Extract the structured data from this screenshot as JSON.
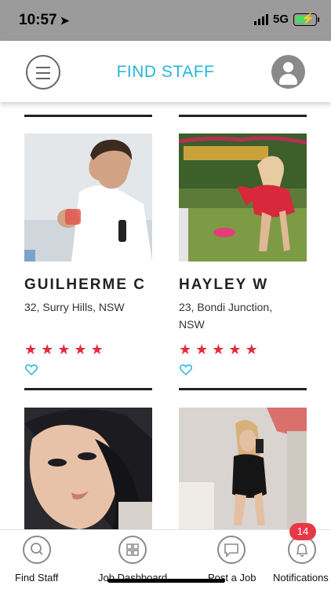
{
  "status_bar": {
    "time": "10:57",
    "location_icon": "location-arrow-icon",
    "network": "5G",
    "battery_level": 0.6
  },
  "header": {
    "title": "FIND STAFF",
    "menu_icon": "hamburger-menu-icon",
    "profile_icon": "user-avatar-icon"
  },
  "staff": [
    {
      "name": "GUILHERME C",
      "details": "32, Surry Hills, NSW",
      "rating": 5
    },
    {
      "name": "HAYLEY W",
      "details": "23, Bondi Junction, NSW",
      "rating": 5
    },
    {
      "name": "",
      "details": "",
      "rating": null
    },
    {
      "name": "",
      "details": "",
      "rating": null
    }
  ],
  "nav": {
    "items": [
      {
        "label": "Find Staff",
        "icon": "search-icon"
      },
      {
        "label": "Job Dashboard",
        "icon": "grid-icon"
      },
      {
        "label": "Post a Job",
        "icon": "chat-bubble-icon"
      },
      {
        "label": "Notifications",
        "icon": "bell-icon"
      }
    ],
    "notification_count": "14"
  },
  "colors": {
    "accent": "#29b6d9",
    "star": "#e42b3a",
    "badge": "#e63946",
    "status_bar": "#9b9b9b"
  }
}
